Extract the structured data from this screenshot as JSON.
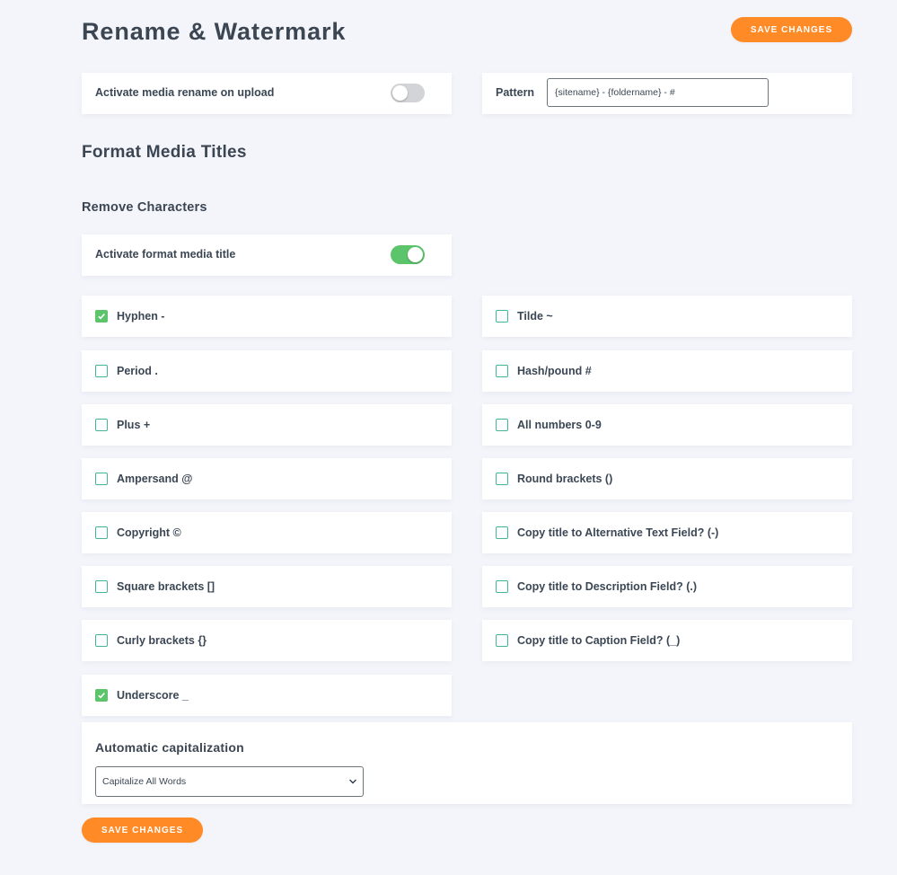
{
  "page": {
    "title": "Rename & Watermark",
    "save_label": "SAVE CHANGES"
  },
  "rename": {
    "activate_label": "Activate media rename on upload",
    "activate_on": false,
    "pattern_label": "Pattern",
    "pattern_value": "{sitename} - {foldername} - #"
  },
  "format": {
    "heading": "Format Media Titles",
    "remove_heading": "Remove Characters",
    "activate_label": "Activate format media title",
    "activate_on": true
  },
  "options": {
    "left": [
      {
        "label": "Hyphen -",
        "checked": true
      },
      {
        "label": "Period .",
        "checked": false
      },
      {
        "label": "Plus +",
        "checked": false
      },
      {
        "label": "Ampersand @",
        "checked": false
      },
      {
        "label": "Copyright ©",
        "checked": false
      },
      {
        "label": "Square brackets []",
        "checked": false
      },
      {
        "label": "Curly brackets {}",
        "checked": false
      },
      {
        "label": "Underscore _",
        "checked": true
      }
    ],
    "right": [
      {
        "label": "Tilde ~",
        "checked": false
      },
      {
        "label": "Hash/pound #",
        "checked": false
      },
      {
        "label": "All numbers 0-9",
        "checked": false
      },
      {
        "label": "Round brackets ()",
        "checked": false
      },
      {
        "label": "Copy title to Alternative Text Field? (-)",
        "checked": false
      },
      {
        "label": "Copy title to Description Field? (.)",
        "checked": false
      },
      {
        "label": "Copy title to Caption Field? (_)",
        "checked": false
      }
    ]
  },
  "capitalization": {
    "heading": "Automatic capitalization",
    "selected": "Capitalize All Words"
  },
  "colors": {
    "accent": "#ff8a26",
    "toggle_on": "#5cc46b",
    "checkbox_border": "#43b59a",
    "background": "#f3f5fb"
  },
  "icons": {
    "checkmark": "check-icon",
    "dropdown": "chevron-down-icon"
  }
}
